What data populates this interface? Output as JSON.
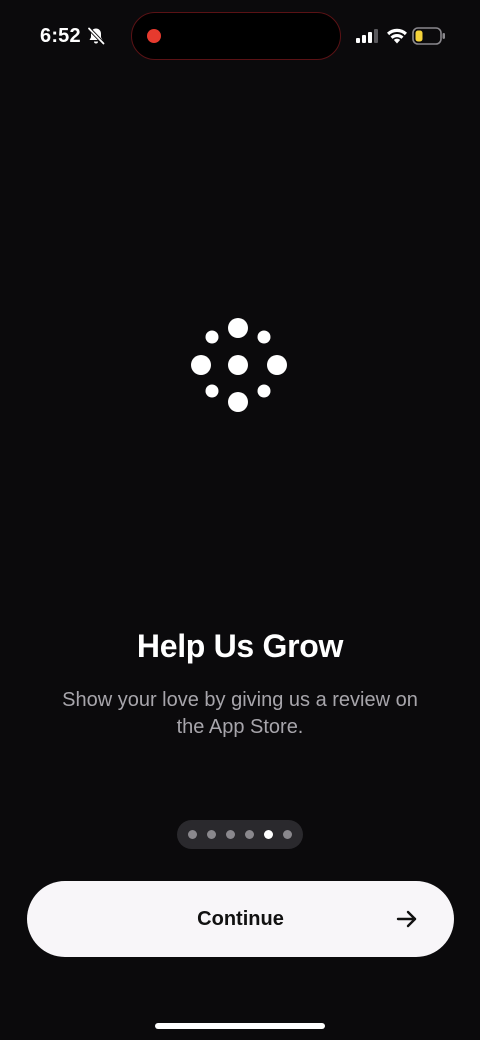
{
  "status_bar": {
    "time": "6:52",
    "icons": {
      "silent": "bell-slash-icon",
      "signal": "cellular-signal-icon",
      "wifi": "wifi-icon",
      "battery": "battery-low-icon"
    },
    "recording_indicator_color": "#e63a2e",
    "battery_level_fraction": 0.25
  },
  "onboarding": {
    "loader_icon": "dots-spinner-icon",
    "title": "Help Us Grow",
    "subtitle": "Show your love by giving us a review on the App Store.",
    "page_indicator": {
      "total_pages": 6,
      "current_page": 5
    }
  },
  "continue_button": {
    "label": "Continue",
    "icon": "arrow-right-icon"
  },
  "colors": {
    "background": "#0b0a0c",
    "text_primary": "#ffffff",
    "text_secondary": "#a7a5ab",
    "button_background": "#f8f6f9",
    "button_text": "#111111"
  }
}
